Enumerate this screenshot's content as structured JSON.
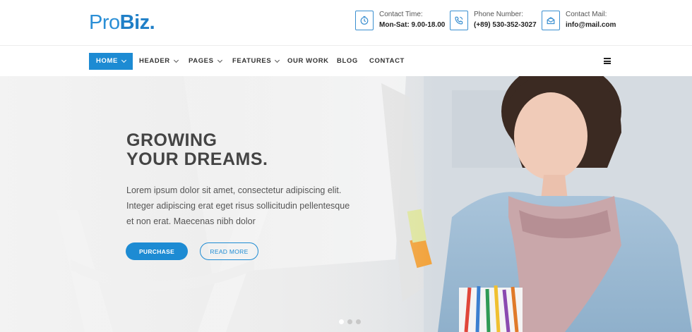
{
  "logo": {
    "part1": "Pro",
    "part2": "Biz",
    "dot": "."
  },
  "contact": [
    {
      "icon": "clock-icon",
      "label": "Contact Time:",
      "value": "Mon-Sat: 9.00-18.00"
    },
    {
      "icon": "phone-icon",
      "label": "Phone Number:",
      "value": "(+89) 530-352-3027"
    },
    {
      "icon": "mail-icon",
      "label": "Contact Mail:",
      "value": "info@mail.com"
    }
  ],
  "nav": {
    "items": [
      {
        "label": "HOME",
        "dropdown": true,
        "active": true
      },
      {
        "label": "HEADER",
        "dropdown": true
      },
      {
        "label": "PAGES",
        "dropdown": true
      },
      {
        "label": "FEATURES",
        "dropdown": true
      },
      {
        "label": "OUR WORK",
        "dropdown": false
      },
      {
        "label": "BLOG",
        "dropdown": false
      },
      {
        "label": "CONTACT",
        "dropdown": false
      }
    ],
    "menu_icon": "hamburger-icon"
  },
  "hero": {
    "title_line1": "GROWING",
    "title_line2": "YOUR DREAMS.",
    "text": "Lorem ipsum dolor sit amet, consectetur adipiscing elit. Integer adipiscing erat eget risus sollicitudin pellentesque et non erat. Maecenas nibh dolor",
    "primary_button": "PURCHASE",
    "secondary_button": "READ MORE",
    "slides": 3,
    "active_slide": 1
  },
  "colors": {
    "accent": "#1d8bd3",
    "logo_light": "#2b8fd6",
    "text_dark": "#444444"
  }
}
